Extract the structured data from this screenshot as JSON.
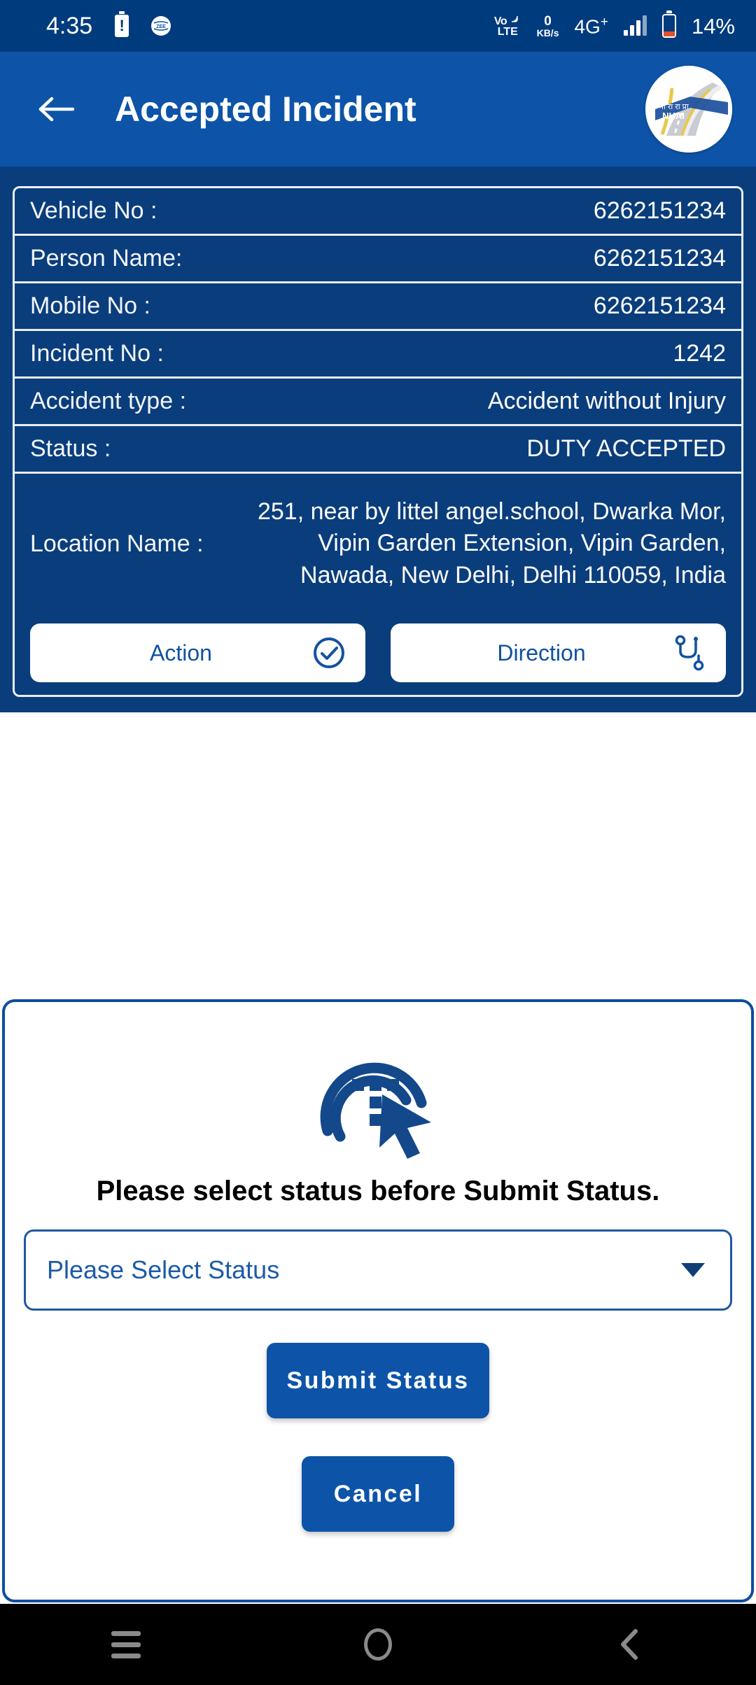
{
  "status_bar": {
    "clock": "4:35",
    "battery_alert_icon": "battery-alert-icon",
    "app_notification_icon": "app-notification-icon",
    "volte_top": "Vo",
    "volte_bottom": "LTE",
    "data_rate_value": "0",
    "data_rate_unit": "KB/s",
    "network_type": "4G",
    "network_type_sup": "+",
    "battery_percent": "14%"
  },
  "app_bar": {
    "back_icon": "back-arrow-icon",
    "title": "Accepted Incident",
    "logo_alt": "NHAI",
    "logo_hindi": "भा रा रा प्रा"
  },
  "incident": {
    "rows": [
      {
        "label": "Vehicle No :",
        "value": "6262151234"
      },
      {
        "label": "Person Name:",
        "value": "6262151234"
      },
      {
        "label": "Mobile No :",
        "value": "6262151234"
      },
      {
        "label": "Incident No :",
        "value": "1242"
      },
      {
        "label": "Accident type :",
        "value": "Accident without Injury"
      },
      {
        "label": "Status :",
        "value": "DUTY ACCEPTED"
      }
    ],
    "location_label": "Location Name :",
    "location_value": "251, near by littel angel.school, Dwarka Mor, Vipin Garden Extension, Vipin Garden, Nawada, New Delhi, Delhi 110059, India",
    "action_button": "Action",
    "action_icon": "check-circle-icon",
    "direction_button": "Direction",
    "direction_icon": "route-icon"
  },
  "dialog": {
    "icon": "tap-select-cursor-icon",
    "heading": "Please select status before Submit Status.",
    "select_value": "Please Select Status",
    "select_caret_icon": "chevron-down-icon",
    "submit_label": "Submit Status",
    "cancel_label": "Cancel"
  },
  "nav_bar": {
    "recents_icon": "recents-menu-icon",
    "home_icon": "home-circle-icon",
    "back_icon": "back-chevron-icon"
  },
  "colors": {
    "status_bar_bg": "#003b7e",
    "app_bar_bg": "#0d54a8",
    "panel_bg": "#0a3d7c",
    "accent_blue": "#0d4e9e",
    "white": "#ffffff",
    "nav_bg": "#000000",
    "battery_low": "#e2502a"
  }
}
